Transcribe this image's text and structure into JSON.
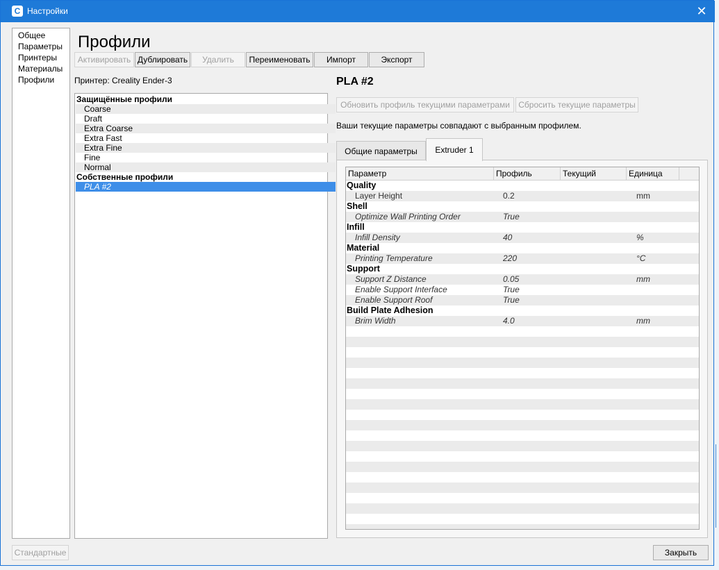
{
  "window": {
    "title": "Настройки",
    "close_symbol": "✕",
    "icon_letter": "C"
  },
  "nav": {
    "items": [
      "Общее",
      "Параметры",
      "Принтеры",
      "Материалы",
      "Профили"
    ]
  },
  "page": {
    "title": "Профили"
  },
  "toolbar": {
    "activate": "Активировать",
    "duplicate": "Дублировать",
    "delete": "Удалить",
    "rename": "Переименовать",
    "import": "Импорт",
    "export": "Экспорт"
  },
  "printer_label": "Принтер: Creality Ender-3",
  "profiles": {
    "protected_header": "Защищённые профили",
    "protected": [
      "Coarse",
      "Draft",
      "Extra Coarse",
      "Extra Fast",
      "Extra Fine",
      "Fine",
      "Normal"
    ],
    "custom_header": "Собственные профили",
    "custom": [
      "PLA #2"
    ]
  },
  "detail": {
    "name": "PLA #2",
    "update_button": "Обновить профиль текущими параметрами",
    "reset_button": "Сбросить текущие параметры",
    "match_text": "Ваши текущие параметры совпадают с выбранным профилем."
  },
  "tabs": [
    "Общие параметры",
    "Extruder 1"
  ],
  "table": {
    "headers": [
      "Параметр",
      "Профиль",
      "Текущий",
      "Единица"
    ],
    "rows": [
      {
        "kind": "cat",
        "name": "Quality"
      },
      {
        "kind": "bare",
        "name": "Layer Height",
        "profile": "0.2",
        "unit": "mm"
      },
      {
        "kind": "cat",
        "name": "Shell"
      },
      {
        "kind": "it",
        "name": "Optimize Wall Printing Order",
        "profile": "True",
        "unit": ""
      },
      {
        "kind": "cat",
        "name": "Infill"
      },
      {
        "kind": "it",
        "name": "Infill Density",
        "profile": "40",
        "unit": "%"
      },
      {
        "kind": "cat",
        "name": "Material"
      },
      {
        "kind": "it",
        "name": "Printing Temperature",
        "profile": "220",
        "unit": "°C"
      },
      {
        "kind": "cat",
        "name": "Support"
      },
      {
        "kind": "it",
        "name": "Support Z Distance",
        "profile": "0.05",
        "unit": "mm"
      },
      {
        "kind": "it",
        "name": "Enable Support Interface",
        "profile": "True",
        "unit": ""
      },
      {
        "kind": "it",
        "name": "Enable Support Roof",
        "profile": "True",
        "unit": ""
      },
      {
        "kind": "cat",
        "name": "Build Plate Adhesion"
      },
      {
        "kind": "it",
        "name": "Brim Width",
        "profile": "4.0",
        "unit": "mm"
      }
    ]
  },
  "footer": {
    "defaults": "Стандартные",
    "close": "Закрыть"
  },
  "colors": {
    "titlebar": "#1e7ad8",
    "selection": "#3e8ee8"
  }
}
